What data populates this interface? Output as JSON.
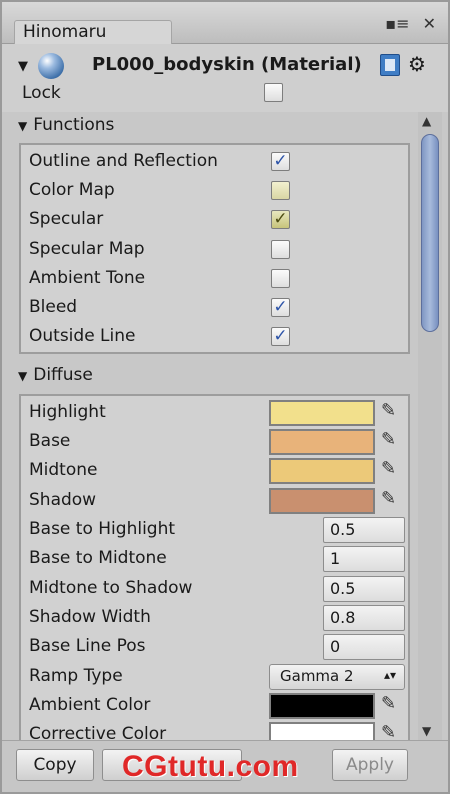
{
  "window": {
    "tab_label": "Hinomaru",
    "controls": [
      "▪≡",
      "✕"
    ]
  },
  "material": {
    "title": "PL000_bodyskin (Material)",
    "lock_label": "Lock",
    "lock_checked": false
  },
  "functions": {
    "header": "Functions",
    "items": [
      {
        "label": "Outline and Reflection",
        "state": "checked"
      },
      {
        "label": "Color Map",
        "state": "partial"
      },
      {
        "label": "Specular",
        "state": "checked-olive"
      },
      {
        "label": "Specular Map",
        "state": "unchecked"
      },
      {
        "label": "Ambient Tone",
        "state": "unchecked"
      },
      {
        "label": "Bleed",
        "state": "checked"
      },
      {
        "label": "Outside Line",
        "state": "checked"
      }
    ]
  },
  "diffuse": {
    "header": "Diffuse",
    "colors": [
      {
        "label": "Highlight",
        "color": "#f2e08c"
      },
      {
        "label": "Base",
        "color": "#e8b37a"
      },
      {
        "label": "Midtone",
        "color": "#ecc979"
      },
      {
        "label": "Shadow",
        "color": "#c9906f"
      }
    ],
    "numbers": [
      {
        "label": "Base to Highlight",
        "value": "0.5"
      },
      {
        "label": "Base to Midtone",
        "value": "1"
      },
      {
        "label": "Midtone to Shadow",
        "value": "0.5"
      },
      {
        "label": "Shadow Width",
        "value": "0.8"
      },
      {
        "label": "Base Line Pos",
        "value": "0"
      }
    ],
    "ramp_type": {
      "label": "Ramp Type",
      "value": "Gamma 2"
    },
    "ambient_color": {
      "label": "Ambient Color",
      "color": "#000000"
    },
    "corrective_color": {
      "label": "Corrective Color",
      "color": "#ffffff"
    }
  },
  "footer": {
    "copy_label": "Copy",
    "apply_label": "Apply"
  },
  "watermark": {
    "text": "CGtutu.com"
  }
}
